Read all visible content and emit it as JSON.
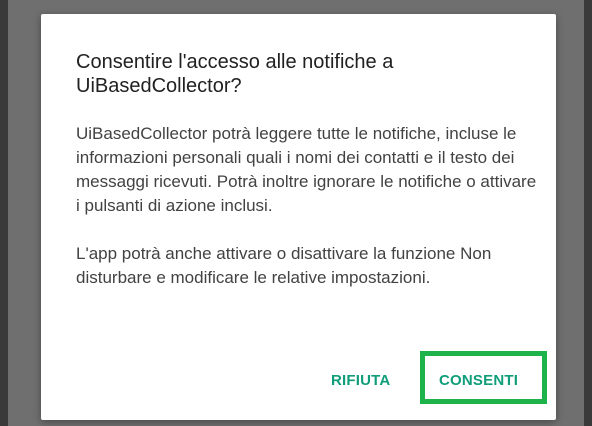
{
  "dialog": {
    "title": "Consentire l'accesso alle notifiche a UiBasedCollector?",
    "body_paragraph_1": "UiBasedCollector potrà leggere tutte le notifiche, incluse le informazioni personali quali i nomi dei contatti e il testo dei messaggi ricevuti. Potrà inoltre ignorare le notifiche o attivare i pulsanti di azione inclusi.",
    "body_paragraph_2": "L'app potrà anche attivare o disattivare la funzione Non disturbare e modificare le relative impostazioni.",
    "deny_label": "RIFIUTA",
    "allow_label": "CONSENTI"
  },
  "colors": {
    "accent": "#0f9d7a",
    "highlight": "#1db24a",
    "scrim": "#6f6f6f"
  }
}
